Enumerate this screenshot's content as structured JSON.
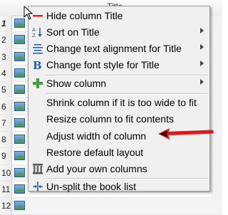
{
  "table": {
    "header_text": "Title",
    "row_numbers": [
      "1",
      "2",
      "3",
      "4",
      "5",
      "6",
      "7",
      "8",
      "9",
      "10",
      "11",
      "12"
    ]
  },
  "context_menu": {
    "items": [
      {
        "label": "Hide column Title",
        "icon": "hide-column-icon",
        "submenu": false
      },
      {
        "label": "Sort on Title",
        "icon": "sort-icon",
        "submenu": true
      },
      {
        "label": "Change text alignment for Title",
        "icon": "text-alignment-icon",
        "submenu": true
      },
      {
        "label": "Change font style for Title",
        "icon": "font-style-icon",
        "submenu": true
      },
      {
        "label": "Show column",
        "icon": "add-column-icon",
        "submenu": true
      },
      {
        "label": "Shrink column if it is too wide to fit",
        "icon": "",
        "submenu": false
      },
      {
        "label": "Resize column to fit contents",
        "icon": "",
        "submenu": false
      },
      {
        "label": "Adjust width of column",
        "icon": "",
        "submenu": false
      },
      {
        "label": "Restore default layout",
        "icon": "",
        "submenu": false
      },
      {
        "label": "Add your own columns",
        "icon": "columns-icon",
        "submenu": false
      },
      {
        "label": "Un-split the book list",
        "icon": "split-icon",
        "submenu": false
      }
    ]
  },
  "colors": {
    "annotation_arrow": "#e8141a",
    "menu_background": "#f0f0f0",
    "add_icon_green": "#3aa335"
  }
}
